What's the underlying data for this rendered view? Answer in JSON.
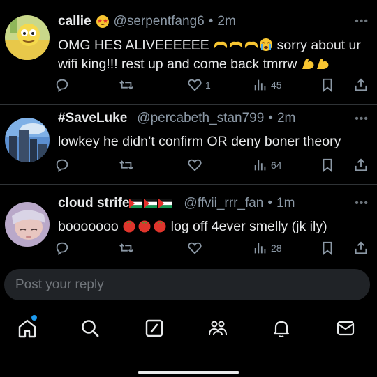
{
  "tweets": [
    {
      "name": "callie",
      "handle": "@serpentfang6",
      "sep": "•",
      "time": "2m",
      "text_1": "OMG HES ALIVEEEEEE ",
      "text_2": " sorry about ur",
      "text_3": "wifi king!!! rest up and come back tmrrw ",
      "likes": "1",
      "views": "45"
    },
    {
      "name": "#SaveLuke",
      "handle": "@percabeth_stan799",
      "sep": "•",
      "time": "2m",
      "text_1": "lowkey he didn’t confirm OR deny boner theory",
      "likes": "",
      "views": "64"
    },
    {
      "name": "cloud strife",
      "handle": "@ffvii_rrr_fan",
      "sep": "•",
      "time": "1m",
      "text_1": "booooooo ",
      "text_2": " log off 4ever smelly (jk ily)",
      "likes": "",
      "views": "28"
    }
  ],
  "more_label": "•••",
  "composer": {
    "placeholder": "Post your reply"
  },
  "nav": [
    "home-icon",
    "search-icon",
    "compose-icon",
    "communities-icon",
    "notifications-icon",
    "messages-icon"
  ],
  "colors": {
    "accent": "#1d9bf0",
    "background": "#000000",
    "muted": "#8b98a5"
  }
}
